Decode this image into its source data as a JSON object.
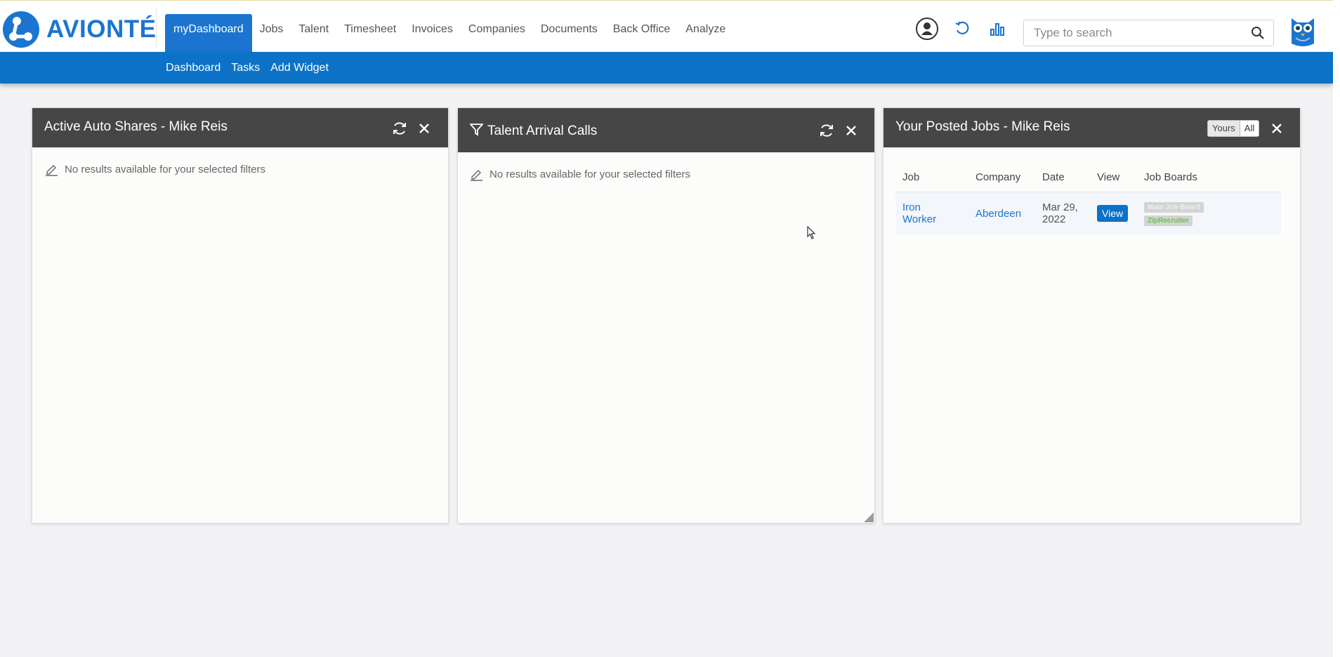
{
  "app": {
    "logo_text": "AVIONTÉ",
    "brand_color": "#1b75d0",
    "header_bar_color": "#0c72c7"
  },
  "nav": {
    "items": [
      {
        "label": "myDashboard",
        "active": true
      },
      {
        "label": "Jobs"
      },
      {
        "label": "Talent"
      },
      {
        "label": "Timesheet"
      },
      {
        "label": "Invoices"
      },
      {
        "label": "Companies"
      },
      {
        "label": "Documents"
      },
      {
        "label": "Back Office"
      },
      {
        "label": "Analyze"
      }
    ]
  },
  "toolbar_icons": [
    "user-profile-icon",
    "refresh-history-icon",
    "bar-chart-icon"
  ],
  "search": {
    "placeholder": "Type to search",
    "value": ""
  },
  "subnav": {
    "items": [
      {
        "label": "Dashboard"
      },
      {
        "label": "Tasks"
      },
      {
        "label": "Add Widget"
      }
    ]
  },
  "widgets": {
    "active_auto_shares": {
      "title": "Active Auto Shares - Mike Reis",
      "empty_text": "No results available for your selected filters"
    },
    "talent_arrival_calls": {
      "title": "Talent Arrival Calls",
      "empty_text": "No results available for your selected filters"
    },
    "posted_jobs": {
      "title": "Your Posted Jobs - Mike Reis",
      "toggle": {
        "yours": "Yours",
        "all": "All"
      },
      "columns": [
        "Job",
        "Company",
        "Date",
        "View",
        "Job Boards"
      ],
      "rows": [
        {
          "job_line1": "Iron",
          "job_line2": "Worker",
          "company": "Aberdeen",
          "date_line1": "Mar 29,",
          "date_line2": "2022",
          "view_label": "View",
          "boards": [
            "Main Job Board",
            "ZipRecruiter"
          ]
        }
      ]
    }
  }
}
